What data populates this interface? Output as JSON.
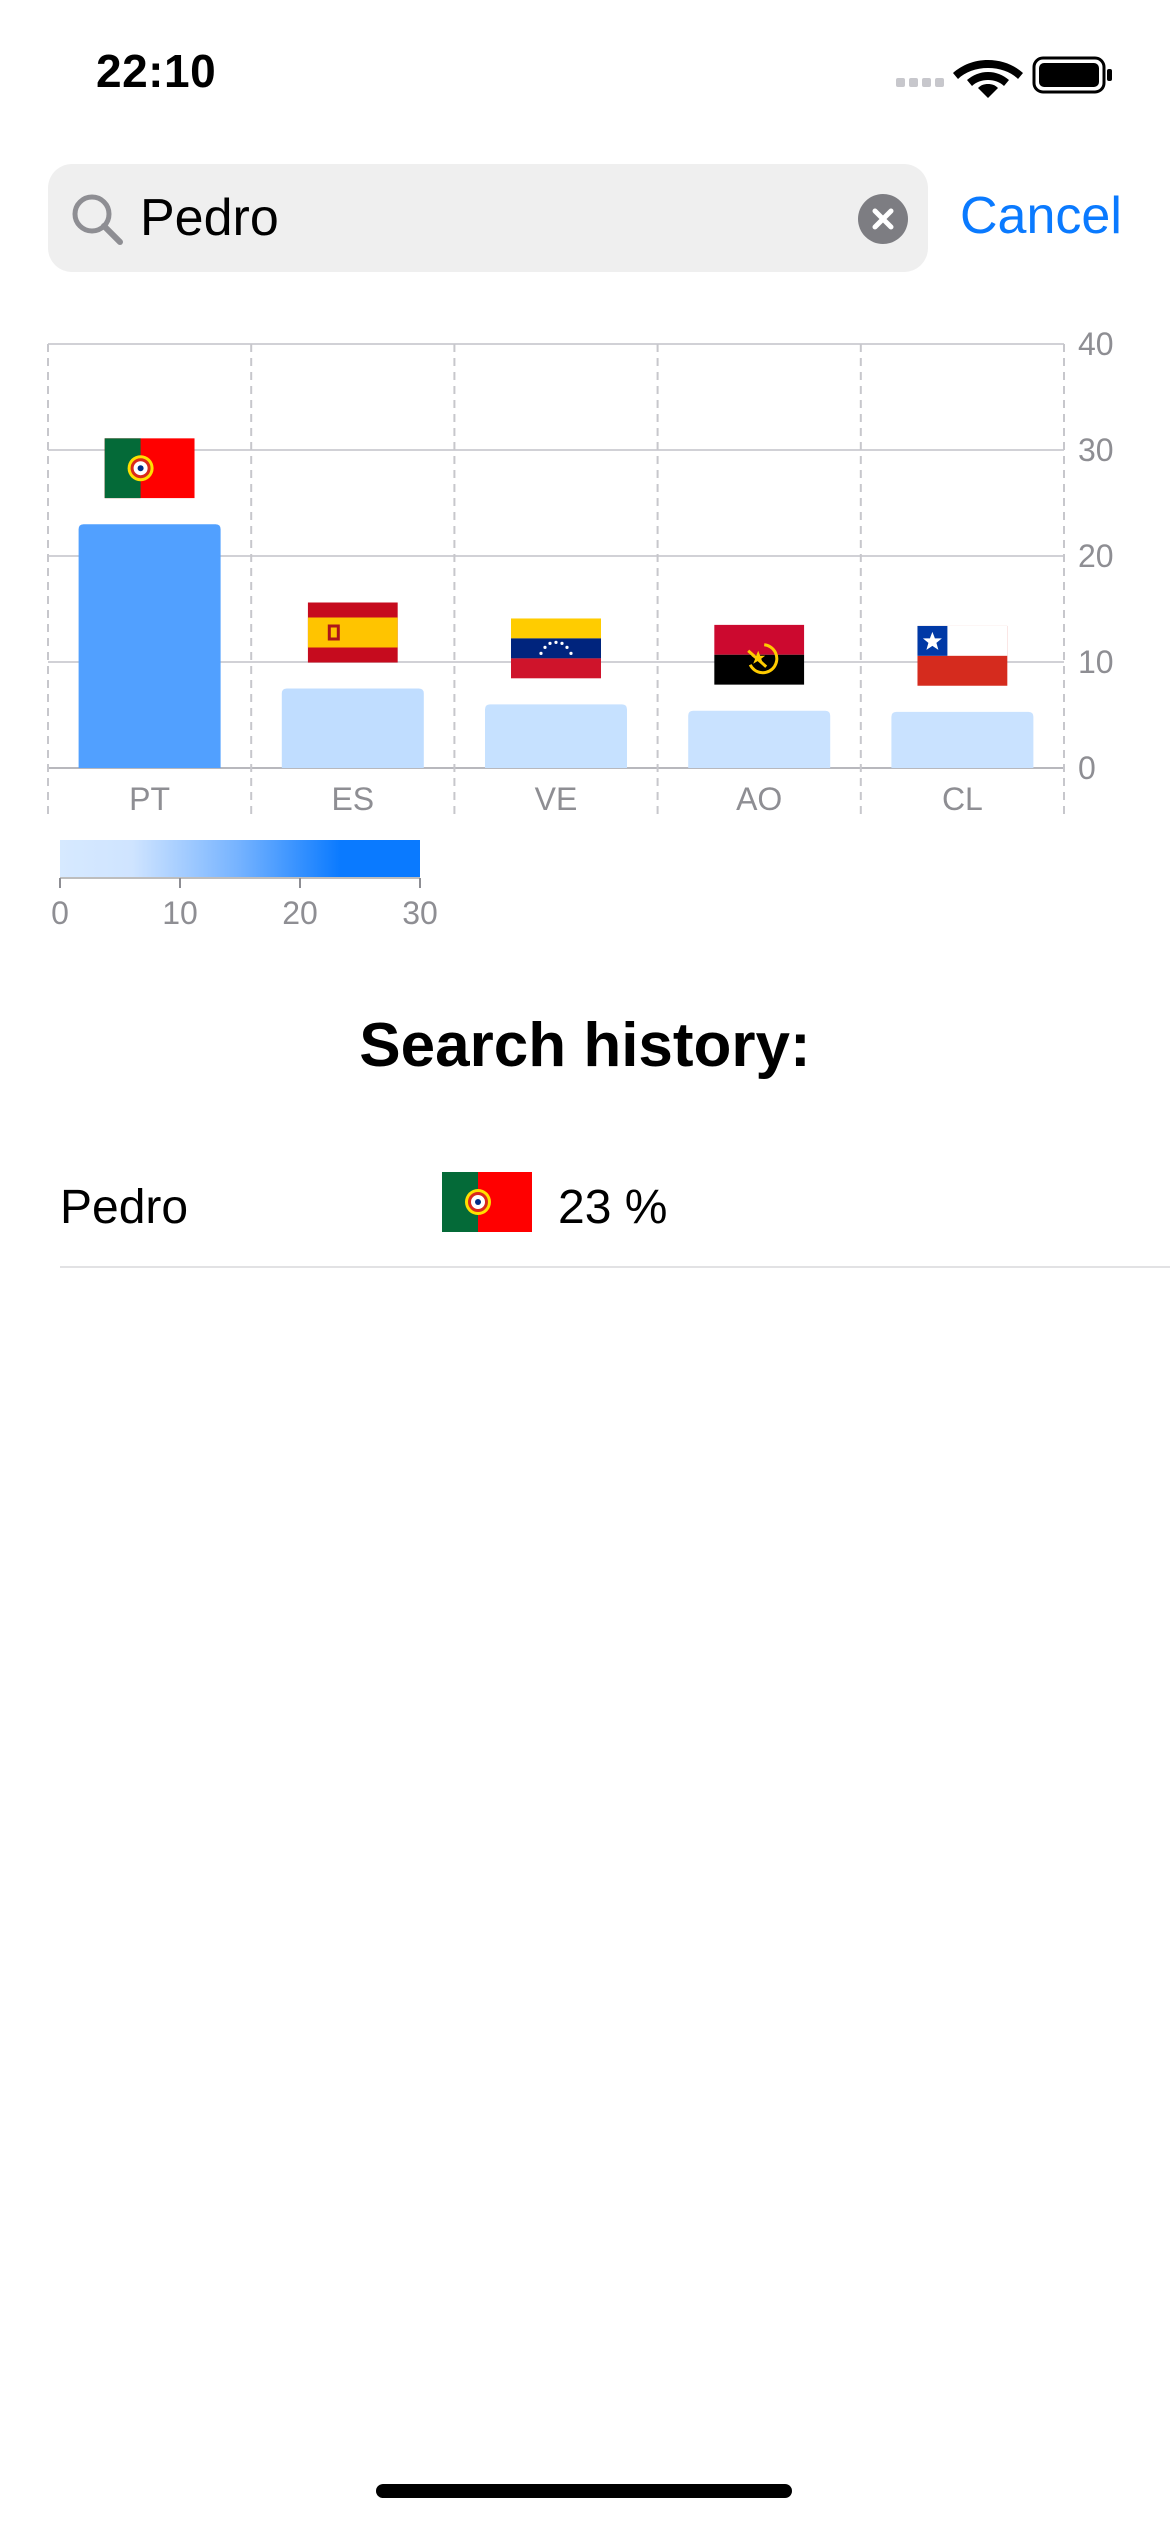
{
  "status_bar": {
    "time": "22:10"
  },
  "search": {
    "query": "Pedro",
    "cancel_label": "Cancel"
  },
  "chart_data": {
    "type": "bar",
    "categories": [
      "PT",
      "ES",
      "VE",
      "AO",
      "CL"
    ],
    "values": [
      23,
      7.5,
      6,
      5.4,
      5.3
    ],
    "ylim": [
      0,
      40
    ],
    "yticks": [
      "0",
      "10",
      "20",
      "30",
      "40"
    ],
    "y_axis_side": "right",
    "grid": true,
    "bar_color_max": "#0a7aff",
    "bar_color_min": "#d6e9ff",
    "flags": [
      "portugal-flag-icon",
      "spain-flag-icon",
      "venezuela-flag-icon",
      "angola-flag-icon",
      "chile-flag-icon"
    ],
    "colorbar": {
      "range": [
        0,
        30
      ],
      "ticks": [
        "0",
        "10",
        "20",
        "30"
      ]
    }
  },
  "history": {
    "title": "Search history:",
    "items": [
      {
        "name": "Pedro",
        "flag": "portugal-flag-icon",
        "value": "23 %"
      }
    ]
  }
}
